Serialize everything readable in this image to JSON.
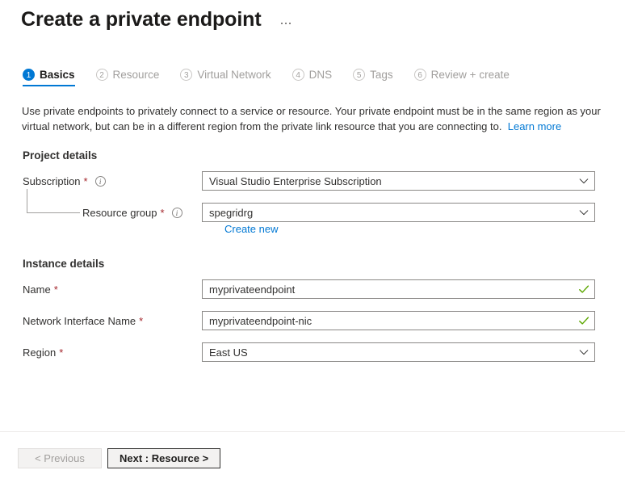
{
  "header": {
    "title": "Create a private endpoint",
    "ellipsis_menu_label": "…"
  },
  "tabs": [
    {
      "num": "1",
      "label": "Basics",
      "active": true
    },
    {
      "num": "2",
      "label": "Resource",
      "active": false
    },
    {
      "num": "3",
      "label": "Virtual Network",
      "active": false
    },
    {
      "num": "4",
      "label": "DNS",
      "active": false
    },
    {
      "num": "5",
      "label": "Tags",
      "active": false
    },
    {
      "num": "6",
      "label": "Review + create",
      "active": false
    }
  ],
  "description": {
    "text": "Use private endpoints to privately connect to a service or resource. Your private endpoint must be in the same region as your virtual network, but can be in a different region from the private link resource that you are connecting to.",
    "learn_more": "Learn more"
  },
  "project_details": {
    "heading": "Project details",
    "subscription": {
      "label": "Subscription",
      "required": "*",
      "value": "Visual Studio Enterprise Subscription"
    },
    "resource_group": {
      "label": "Resource group",
      "required": "*",
      "value": "spegridrg",
      "create_new": "Create new"
    }
  },
  "instance_details": {
    "heading": "Instance details",
    "name": {
      "label": "Name",
      "required": "*",
      "value": "myprivateendpoint"
    },
    "network_interface_name": {
      "label": "Network Interface Name",
      "required": "*",
      "value": "myprivateendpoint-nic"
    },
    "region": {
      "label": "Region",
      "required": "*",
      "value": "East US"
    }
  },
  "footer": {
    "previous_label": "< Previous",
    "next_label": "Next : Resource >"
  },
  "colors": {
    "accent": "#0078d4",
    "required_asterisk": "#a4262c",
    "validation_check": "#5ca700",
    "link": "#0078d4",
    "inactive_tab": "#a19f9d"
  }
}
